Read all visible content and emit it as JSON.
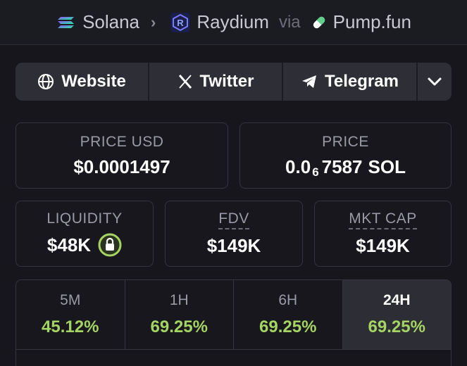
{
  "breadcrumb": {
    "chain": "Solana",
    "dex": "Raydium",
    "via": "via",
    "launchpad": "Pump.fun"
  },
  "links": {
    "website": "Website",
    "twitter": "Twitter",
    "telegram": "Telegram"
  },
  "price_usd": {
    "label": "PRICE USD",
    "value": "$0.0001497"
  },
  "price_native": {
    "label": "PRICE",
    "prefix": "0.0",
    "zeros": "6",
    "digits": "7587",
    "unit": "SOL"
  },
  "liquidity": {
    "label": "LIQUIDITY",
    "value": "$48K"
  },
  "fdv": {
    "label": "FDV",
    "value": "$149K"
  },
  "mkt_cap": {
    "label": "MKT CAP",
    "value": "$149K"
  },
  "changes": [
    {
      "period": "5M",
      "value": "45.12%"
    },
    {
      "period": "1H",
      "value": "69.25%"
    },
    {
      "period": "6H",
      "value": "69.25%"
    },
    {
      "period": "24H",
      "value": "69.25%",
      "active": true
    }
  ],
  "colors": {
    "positive": "#a5d463",
    "background": "#16161c",
    "lock": "#a5d463"
  }
}
